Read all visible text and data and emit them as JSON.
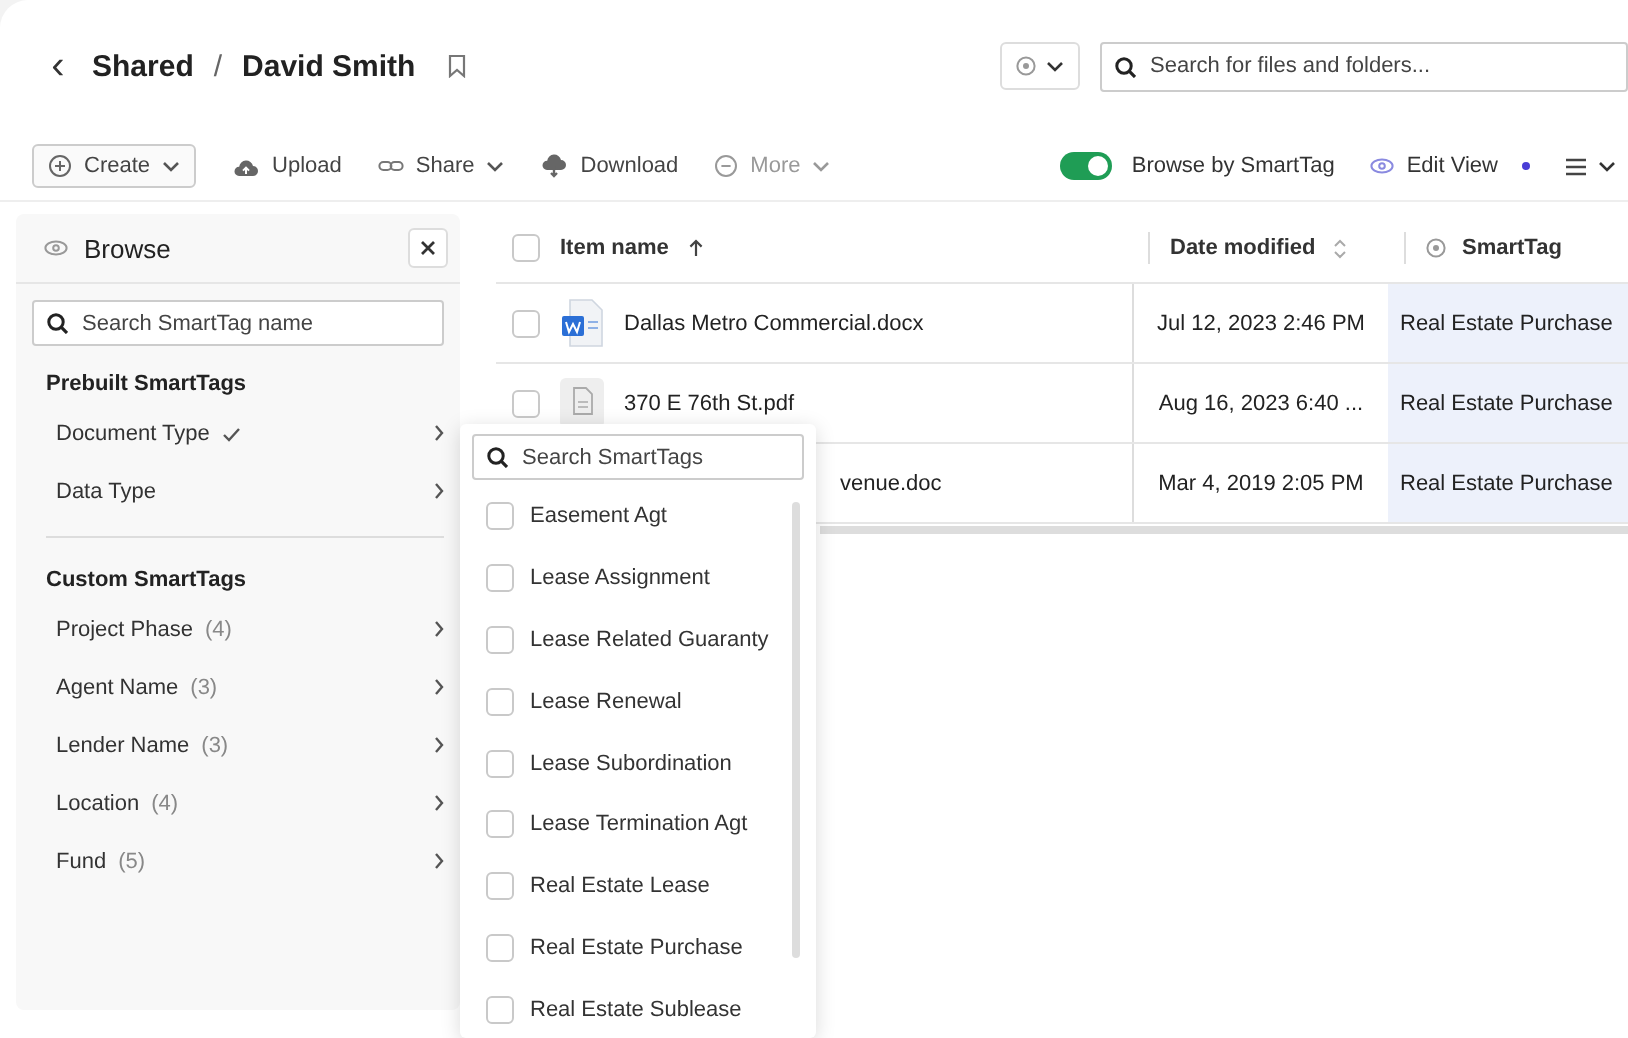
{
  "header": {
    "back": "‹",
    "breadcrumb": [
      {
        "label": "Shared"
      },
      {
        "label": "David Smith"
      }
    ],
    "separator": "/",
    "search": {
      "placeholder": "Search for files and folders..."
    }
  },
  "toolbar": {
    "actions": [
      {
        "kind": "create",
        "label": "Create",
        "disabled": false
      },
      {
        "kind": "upload",
        "label": "Upload",
        "disabled": false
      },
      {
        "kind": "share",
        "label": "Share",
        "disabled": false
      },
      {
        "kind": "download",
        "label": "Download",
        "disabled": false
      },
      {
        "kind": "more",
        "label": "More",
        "disabled": true
      }
    ],
    "smarttag_toggle": {
      "label": "Browse by SmartTag",
      "on": true
    },
    "edit_view": {
      "label": "Edit View",
      "unsaved": true
    }
  },
  "browse": {
    "title": "Browse",
    "search": {
      "placeholder": "Search SmartTag name"
    },
    "sections": [
      {
        "title": "Prebuilt SmartTags",
        "items": [
          {
            "label": "Document Type",
            "checked": true
          },
          {
            "label": "Data Type",
            "checked": false
          }
        ]
      },
      {
        "title": "Custom SmartTags",
        "items": [
          {
            "label": "Project Phase",
            "count": "(4)",
            "checked": false
          },
          {
            "label": "Agent Name",
            "count": "(3)",
            "checked": false
          },
          {
            "label": "Lender Name",
            "count": "(3)",
            "checked": false
          },
          {
            "label": "Location",
            "count": "(4)",
            "checked": false
          },
          {
            "label": "Fund",
            "count": "(5)",
            "checked": false
          }
        ]
      }
    ]
  },
  "table": {
    "select_all": {
      "checked": false
    },
    "columns": [
      {
        "label": "Item name"
      },
      {
        "label": "Date modified"
      },
      {
        "label": "SmartTag"
      }
    ],
    "rows": [
      {
        "kind": "word",
        "name": "Dallas Metro Commercial.docx",
        "date": "Jul 12, 2023 2:46 PM",
        "smarttag": "Real Estate Purchase",
        "checked": false
      },
      {
        "kind": "pdf",
        "name": "370 E 76th St.pdf",
        "date": "Aug 16, 2023 6:40 ...",
        "smarttag": "Real Estate Purchase",
        "checked": false
      },
      {
        "kind": "clipped",
        "name": "venue.doc",
        "date": "Mar 4, 2019 2:05 PM",
        "smarttag": "Real Estate Purchase"
      }
    ]
  },
  "tag_menu": {
    "search": {
      "placeholder": "Search SmartTags"
    },
    "options": [
      {
        "label": "Easement Agt",
        "checked": false
      },
      {
        "label": "Lease Assignment",
        "checked": false
      },
      {
        "label": "Lease Related Guaranty",
        "checked": false
      },
      {
        "label": "Lease Renewal",
        "checked": false
      },
      {
        "label": "Lease Subordination",
        "checked": false
      },
      {
        "label": "Lease Termination Agt",
        "checked": false
      },
      {
        "label": "Real Estate Lease",
        "checked": false
      },
      {
        "label": "Real Estate Purchase",
        "checked": false
      },
      {
        "label": "Real Estate Sublease",
        "checked": false
      }
    ]
  }
}
